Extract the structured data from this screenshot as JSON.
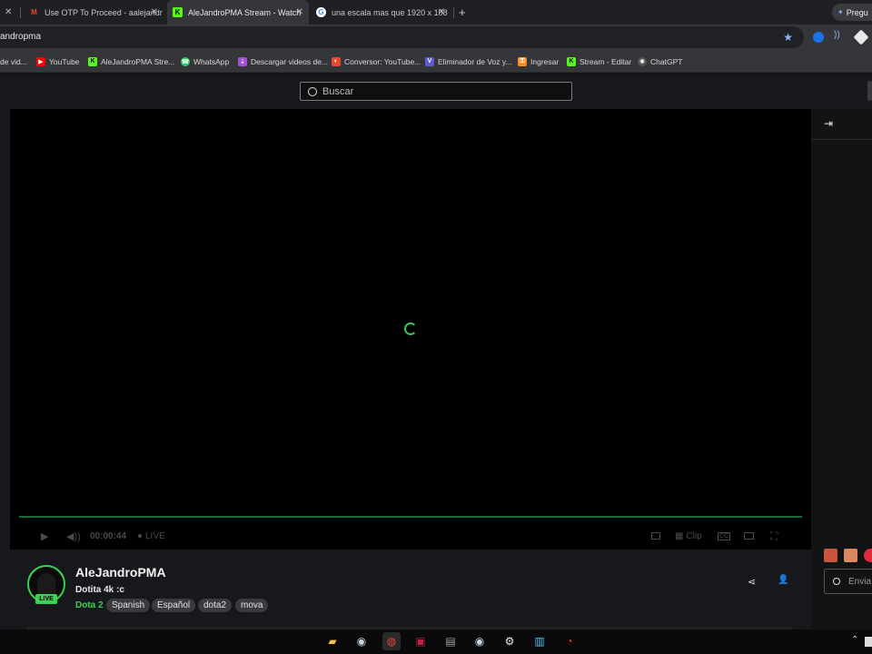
{
  "tabs": [
    {
      "title": "Use OTP To Proceed - aalejandr",
      "favicon": "M",
      "color": "#ea4335"
    },
    {
      "title": "AleJandroPMA Stream - Watch",
      "favicon": "K",
      "color": "#53fc18",
      "active": true
    },
    {
      "title": "una escala mas que 1920 x 108",
      "favicon": "G",
      "color": "#4285f4"
    }
  ],
  "right_btn": "Pregu",
  "address": "andropma",
  "bookmarks": [
    {
      "label": "de vid...",
      "color": "#ffffff"
    },
    {
      "label": "YouTube",
      "color": "#ff0000"
    },
    {
      "label": "AleJandroPMA Stre...",
      "color": "#53fc18"
    },
    {
      "label": "WhatsApp",
      "color": "#25d366"
    },
    {
      "label": "Descargar videos de...",
      "color": "#a34fd6"
    },
    {
      "label": "Conversor: YouTube...",
      "color": "#e64a2e"
    },
    {
      "label": "Eliminador de Voz y...",
      "color": "#5b5bd6"
    },
    {
      "label": "Ingresar",
      "color": "#ff8a1a"
    },
    {
      "label": "Stream - Editar",
      "color": "#53fc18"
    },
    {
      "label": "ChatGPT",
      "color": "#cfcfcf"
    }
  ],
  "search": {
    "placeholder": "Buscar"
  },
  "player": {
    "time": "00:00:44",
    "live": "LIVE",
    "clip": "Clip",
    "cc": "CC"
  },
  "streamer": {
    "name": "AleJandroPMA",
    "title": "Dotita 4k :c",
    "category": "Dota 2",
    "live": "LIVE"
  },
  "tags": [
    "Spanish",
    "Español",
    "dota2",
    "mova"
  ],
  "chat_send": "Envia"
}
